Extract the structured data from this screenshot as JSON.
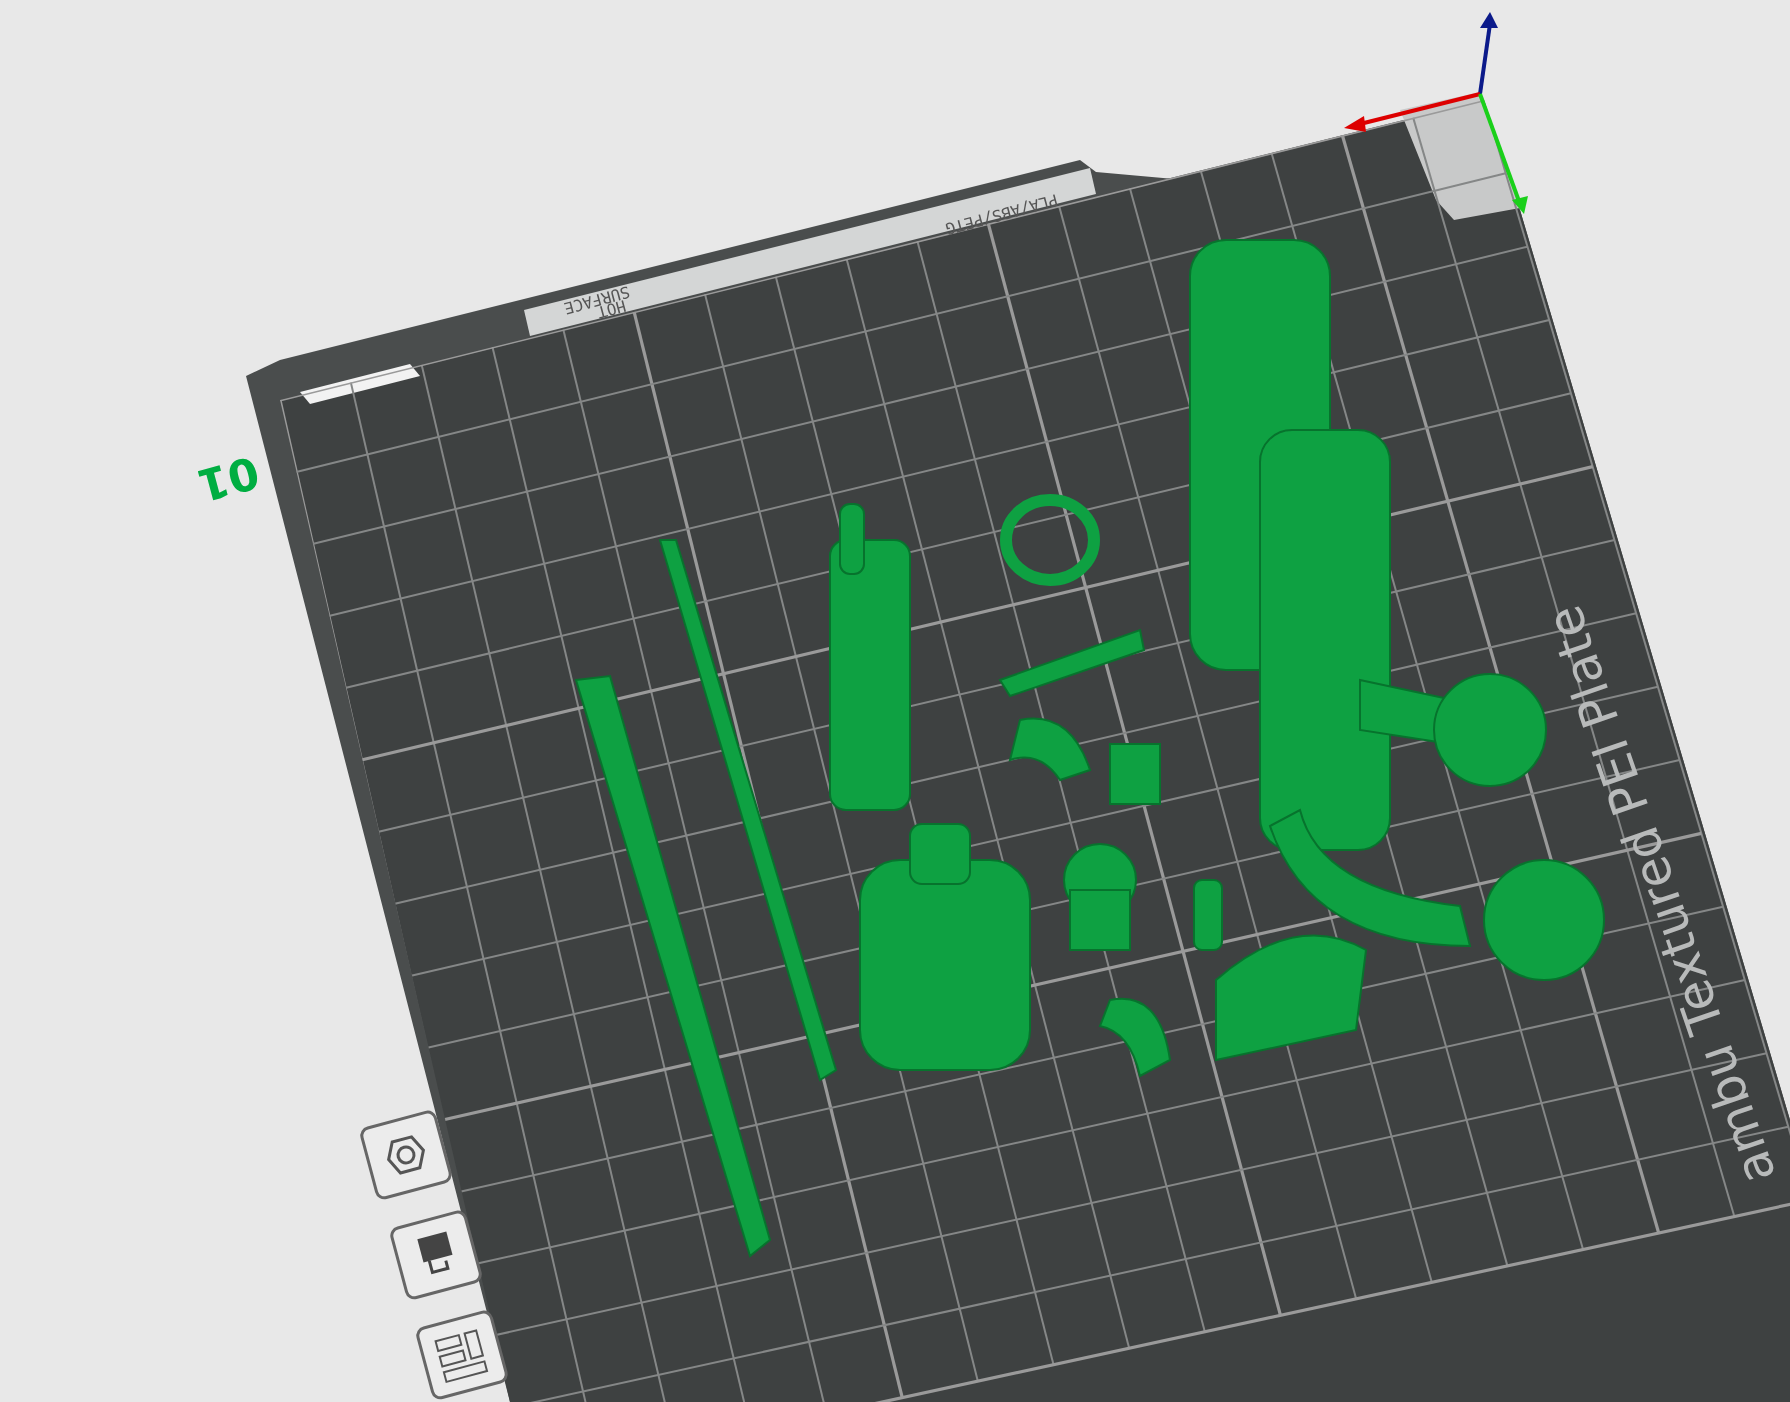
{
  "plate": {
    "number": "01",
    "name": "ambu Textured PEI Plate",
    "bezel_labels": [
      {
        "kind": "material",
        "text": "PLA/ABS/PETG"
      },
      {
        "kind": "warning",
        "text": "HOT"
      },
      {
        "kind": "warning",
        "text": "SURFACE"
      }
    ]
  },
  "toolbar": [
    {
      "kind": "nut"
    },
    {
      "kind": "paint"
    },
    {
      "kind": "layout"
    }
  ]
}
